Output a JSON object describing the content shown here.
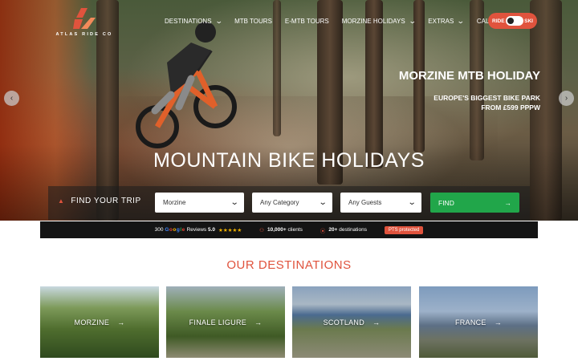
{
  "brand": {
    "name": "ATLAS RIDE CO"
  },
  "nav": {
    "items": [
      {
        "label": "DESTINATIONS",
        "has_dropdown": true
      },
      {
        "label": "MTB TOURS",
        "has_dropdown": false
      },
      {
        "label": "E-MTB TOURS",
        "has_dropdown": false
      },
      {
        "label": "MORZINE HOLIDAYS",
        "has_dropdown": true
      },
      {
        "label": "EXTRAS",
        "has_dropdown": true
      },
      {
        "label": "CALL US",
        "has_dropdown": false
      }
    ],
    "toggle": {
      "left_label": "RIDE",
      "right_label": "SKI",
      "selected": "RIDE"
    }
  },
  "hero": {
    "slide_title": "MORZINE MTB HOLIDAY",
    "slide_subtitle_line1": "EUROPE'S BIGGEST BIKE PARK",
    "slide_subtitle_line2": "FROM £599 PPPW",
    "headline": "MOUNTAIN BIKE HOLIDAYS",
    "prev_arrow": "‹",
    "next_arrow": "›"
  },
  "search": {
    "label": "FIND YOUR TRIP",
    "destination": "Morzine",
    "category": "Any Category",
    "guests": "Any Guests",
    "button": "FIND",
    "button_arrow": "→"
  },
  "stats": {
    "reviews_count": "300",
    "reviews_source": "Google",
    "reviews_word": "Reviews",
    "rating": "5.0",
    "stars": "★★★★★",
    "clients": "10,000+",
    "clients_label": "clients",
    "destinations": "20+",
    "destinations_label": "destinations",
    "badge": "PTS protected"
  },
  "destinations_section": {
    "title": "OUR DESTINATIONS",
    "cards": [
      {
        "label": "MORZINE"
      },
      {
        "label": "FINALE LIGURE"
      },
      {
        "label": "SCOTLAND"
      },
      {
        "label": "FRANCE"
      }
    ]
  },
  "colors": {
    "accent": "#e0533d",
    "cta": "#21a64a",
    "bar": "#141414"
  }
}
